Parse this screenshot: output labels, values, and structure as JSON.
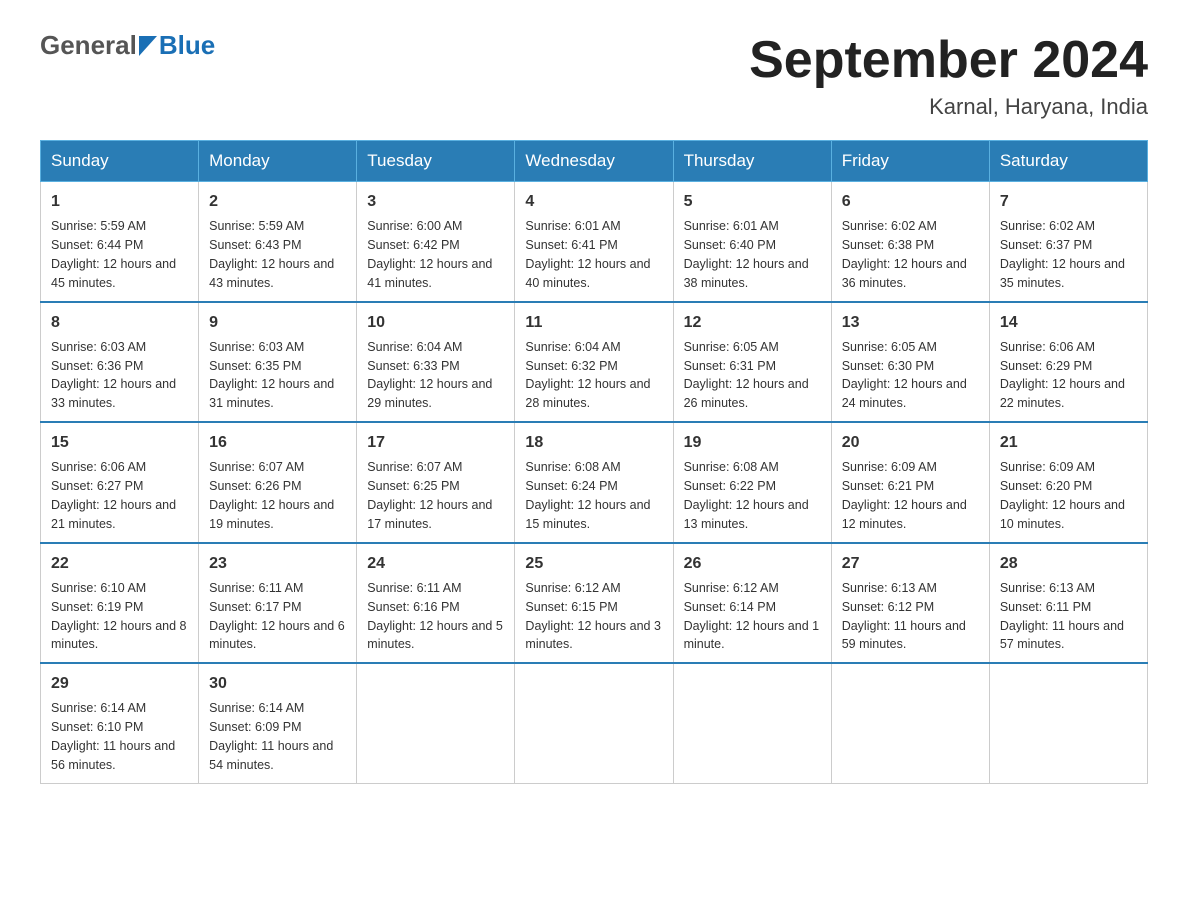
{
  "header": {
    "logo_general": "General",
    "logo_blue": "Blue",
    "title": "September 2024",
    "subtitle": "Karnal, Haryana, India"
  },
  "weekdays": [
    "Sunday",
    "Monday",
    "Tuesday",
    "Wednesday",
    "Thursday",
    "Friday",
    "Saturday"
  ],
  "weeks": [
    [
      {
        "day": "1",
        "sunrise": "5:59 AM",
        "sunset": "6:44 PM",
        "daylight": "12 hours and 45 minutes."
      },
      {
        "day": "2",
        "sunrise": "5:59 AM",
        "sunset": "6:43 PM",
        "daylight": "12 hours and 43 minutes."
      },
      {
        "day": "3",
        "sunrise": "6:00 AM",
        "sunset": "6:42 PM",
        "daylight": "12 hours and 41 minutes."
      },
      {
        "day": "4",
        "sunrise": "6:01 AM",
        "sunset": "6:41 PM",
        "daylight": "12 hours and 40 minutes."
      },
      {
        "day": "5",
        "sunrise": "6:01 AM",
        "sunset": "6:40 PM",
        "daylight": "12 hours and 38 minutes."
      },
      {
        "day": "6",
        "sunrise": "6:02 AM",
        "sunset": "6:38 PM",
        "daylight": "12 hours and 36 minutes."
      },
      {
        "day": "7",
        "sunrise": "6:02 AM",
        "sunset": "6:37 PM",
        "daylight": "12 hours and 35 minutes."
      }
    ],
    [
      {
        "day": "8",
        "sunrise": "6:03 AM",
        "sunset": "6:36 PM",
        "daylight": "12 hours and 33 minutes."
      },
      {
        "day": "9",
        "sunrise": "6:03 AM",
        "sunset": "6:35 PM",
        "daylight": "12 hours and 31 minutes."
      },
      {
        "day": "10",
        "sunrise": "6:04 AM",
        "sunset": "6:33 PM",
        "daylight": "12 hours and 29 minutes."
      },
      {
        "day": "11",
        "sunrise": "6:04 AM",
        "sunset": "6:32 PM",
        "daylight": "12 hours and 28 minutes."
      },
      {
        "day": "12",
        "sunrise": "6:05 AM",
        "sunset": "6:31 PM",
        "daylight": "12 hours and 26 minutes."
      },
      {
        "day": "13",
        "sunrise": "6:05 AM",
        "sunset": "6:30 PM",
        "daylight": "12 hours and 24 minutes."
      },
      {
        "day": "14",
        "sunrise": "6:06 AM",
        "sunset": "6:29 PM",
        "daylight": "12 hours and 22 minutes."
      }
    ],
    [
      {
        "day": "15",
        "sunrise": "6:06 AM",
        "sunset": "6:27 PM",
        "daylight": "12 hours and 21 minutes."
      },
      {
        "day": "16",
        "sunrise": "6:07 AM",
        "sunset": "6:26 PM",
        "daylight": "12 hours and 19 minutes."
      },
      {
        "day": "17",
        "sunrise": "6:07 AM",
        "sunset": "6:25 PM",
        "daylight": "12 hours and 17 minutes."
      },
      {
        "day": "18",
        "sunrise": "6:08 AM",
        "sunset": "6:24 PM",
        "daylight": "12 hours and 15 minutes."
      },
      {
        "day": "19",
        "sunrise": "6:08 AM",
        "sunset": "6:22 PM",
        "daylight": "12 hours and 13 minutes."
      },
      {
        "day": "20",
        "sunrise": "6:09 AM",
        "sunset": "6:21 PM",
        "daylight": "12 hours and 12 minutes."
      },
      {
        "day": "21",
        "sunrise": "6:09 AM",
        "sunset": "6:20 PM",
        "daylight": "12 hours and 10 minutes."
      }
    ],
    [
      {
        "day": "22",
        "sunrise": "6:10 AM",
        "sunset": "6:19 PM",
        "daylight": "12 hours and 8 minutes."
      },
      {
        "day": "23",
        "sunrise": "6:11 AM",
        "sunset": "6:17 PM",
        "daylight": "12 hours and 6 minutes."
      },
      {
        "day": "24",
        "sunrise": "6:11 AM",
        "sunset": "6:16 PM",
        "daylight": "12 hours and 5 minutes."
      },
      {
        "day": "25",
        "sunrise": "6:12 AM",
        "sunset": "6:15 PM",
        "daylight": "12 hours and 3 minutes."
      },
      {
        "day": "26",
        "sunrise": "6:12 AM",
        "sunset": "6:14 PM",
        "daylight": "12 hours and 1 minute."
      },
      {
        "day": "27",
        "sunrise": "6:13 AM",
        "sunset": "6:12 PM",
        "daylight": "11 hours and 59 minutes."
      },
      {
        "day": "28",
        "sunrise": "6:13 AM",
        "sunset": "6:11 PM",
        "daylight": "11 hours and 57 minutes."
      }
    ],
    [
      {
        "day": "29",
        "sunrise": "6:14 AM",
        "sunset": "6:10 PM",
        "daylight": "11 hours and 56 minutes."
      },
      {
        "day": "30",
        "sunrise": "6:14 AM",
        "sunset": "6:09 PM",
        "daylight": "11 hours and 54 minutes."
      },
      null,
      null,
      null,
      null,
      null
    ]
  ],
  "labels": {
    "sunrise_prefix": "Sunrise: ",
    "sunset_prefix": "Sunset: ",
    "daylight_prefix": "Daylight: "
  }
}
